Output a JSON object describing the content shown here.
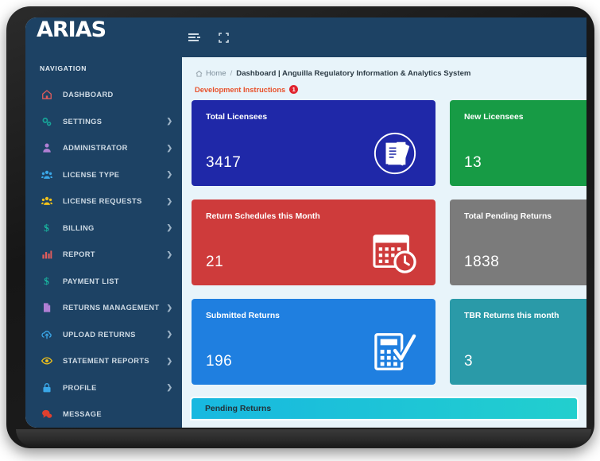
{
  "brand": {
    "logo_text": "ARIAS"
  },
  "sidebar": {
    "section_label": "NAVIGATION",
    "items": [
      {
        "label": "DASHBOARD",
        "icon": "home-icon",
        "icon_color": "#e05c5c",
        "glyph": "⌂",
        "has_chevron": false
      },
      {
        "label": "SETTINGS",
        "icon": "gears-icon",
        "icon_color": "#17a398",
        "glyph": "⚙",
        "has_chevron": true
      },
      {
        "label": "ADMINISTRATOR",
        "icon": "user-icon",
        "icon_color": "#b07fd4",
        "glyph": "♟",
        "has_chevron": true
      },
      {
        "label": "LICENSE TYPE",
        "icon": "users-icon",
        "icon_color": "#3aa7e8",
        "glyph": "♟",
        "has_chevron": true
      },
      {
        "label": "LICENSE REQUESTS",
        "icon": "users-group-icon",
        "icon_color": "#f2c21a",
        "glyph": "♟",
        "has_chevron": true
      },
      {
        "label": "BILLING",
        "icon": "dollar-icon",
        "icon_color": "#19b5a0",
        "glyph": "$",
        "has_chevron": true
      },
      {
        "label": "REPORT",
        "icon": "bar-chart-icon",
        "icon_color": "#e05c5c",
        "glyph": "█",
        "has_chevron": true
      },
      {
        "label": "PAYMENT LIST",
        "icon": "dollar-icon",
        "icon_color": "#19b5a0",
        "glyph": "$",
        "has_chevron": false
      },
      {
        "label": "RETURNS MANAGEMENT",
        "icon": "document-icon",
        "icon_color": "#b07fd4",
        "glyph": "▮",
        "has_chevron": true
      },
      {
        "label": "UPLOAD RETURNS",
        "icon": "cloud-upload-icon",
        "icon_color": "#3aa7e8",
        "glyph": "☁",
        "has_chevron": true
      },
      {
        "label": "STATEMENT REPORTS",
        "icon": "eye-icon",
        "icon_color": "#f2c21a",
        "glyph": "◉",
        "has_chevron": true
      },
      {
        "label": "PROFILE",
        "icon": "lock-icon",
        "icon_color": "#3aa7e8",
        "glyph": "■",
        "has_chevron": true
      },
      {
        "label": "MESSAGE",
        "icon": "chat-bubble-icon",
        "icon_color": "#e0402f",
        "glyph": "●",
        "has_chevron": false
      }
    ]
  },
  "topbar": {
    "menu_toggle": "menu-toggle-icon",
    "fullscreen": "fullscreen-expand-icon"
  },
  "breadcrumb": {
    "home": "Home",
    "separator": "/",
    "current": "Dashboard | Anguilla Regulatory Information & Analytics System"
  },
  "notice": {
    "text": "Development Instructions",
    "badge_count": "1",
    "text_color": "#e8502a",
    "badge_color": "#e0232e"
  },
  "cards": [
    {
      "title": "Total Licensees",
      "value": "3417",
      "color": "#1f28a8",
      "icon": "documents-stack-icon"
    },
    {
      "title": "New Licensees",
      "value": "13",
      "color": "#179b45",
      "icon": "none"
    },
    {
      "title": "Return Schedules this Month",
      "value": "21",
      "color": "#ce3b3b",
      "icon": "calendar-clock-icon"
    },
    {
      "title": "Total Pending Returns",
      "value": "1838",
      "color": "#7b7b7b",
      "icon": "none"
    },
    {
      "title": "Submitted Returns",
      "value": "196",
      "color": "#1f7fe0",
      "icon": "calculator-check-icon"
    },
    {
      "title": "TBR Returns this month",
      "value": "3",
      "color": "#2a9aa8",
      "icon": "none"
    }
  ],
  "panel": {
    "pending_returns_title": "Pending Returns"
  }
}
